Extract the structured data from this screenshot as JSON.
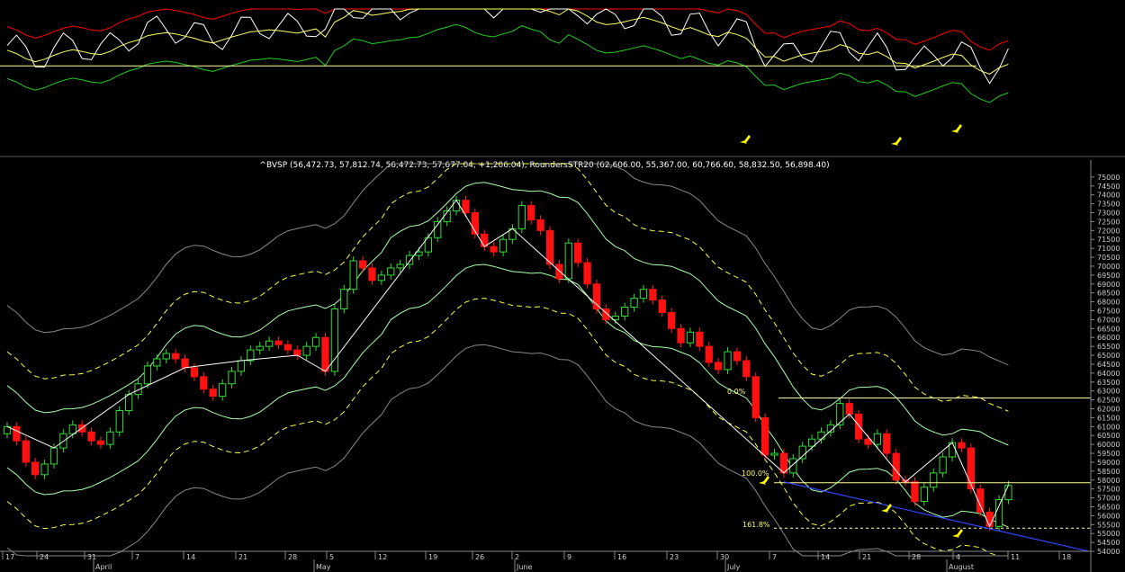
{
  "chart_data": [
    {
      "type": "line",
      "panel": "indicator",
      "title": "",
      "series": [
        {
          "color": "#ff0000",
          "values": [
            76.3,
            76.3,
            76.3,
            76.3,
            76.3,
            76.3,
            76.3,
            76.3,
            76.3,
            76.3,
            76.3,
            76.3,
            76.3,
            76.3,
            76.3,
            76.3,
            76.3,
            76.3,
            76.3,
            76.3,
            76.3,
            76.3,
            76.3,
            76.3,
            76.3,
            76.3,
            76.3,
            76.3,
            76.3,
            76.3,
            76.3,
            76.3,
            76.3,
            76.3,
            76.3,
            76.3,
            76.3,
            76.3,
            76.3,
            76.3,
            76.3,
            76.3,
            76.3,
            76.3,
            76.3,
            76.3,
            76.3,
            76.3,
            76.3,
            76.3,
            76.3,
            76.3,
            76.3,
            76.3,
            76.3,
            76.3,
            76.3,
            76.3,
            76.3,
            76.3,
            76.3,
            76.3,
            76.3,
            76.3,
            76.3,
            76.3,
            76.3,
            76.3,
            76.3,
            76.3,
            76.3,
            76.3,
            76.3,
            76.3,
            76.3,
            76.3,
            76.3,
            76.3,
            76.3,
            76.3,
            76.3,
            76.3,
            76.3,
            76.3,
            76.3,
            76.3,
            76.3,
            76.3,
            76.3,
            76.3,
            76.3,
            76.3,
            76.3,
            76.3,
            76.3,
            76.3,
            76.3,
            76.3,
            76.3,
            76.3
          ]
        },
        {
          "color": "#ffffff",
          "values": []
        },
        {
          "color": "#ffff66",
          "values": []
        },
        {
          "color": "#22cc22",
          "values": []
        }
      ],
      "hlines": [
        {
          "color": "#ffff99"
        }
      ]
    },
    {
      "type": "candlestick",
      "panel": "price",
      "title": "^BVSP (56,472.73, 57,812.74, 56,472.73, 57,677.04, +1,206.04), RoundersSTR20 (62,606.00, 55,367.00, 60,766.60, 58,832.50, 56,898.40)",
      "ylim": [
        53750,
        75750
      ],
      "y_ticks": [
        54000,
        54500,
        55000,
        55500,
        56000,
        56500,
        57000,
        57500,
        58000,
        58500,
        59000,
        59500,
        60000,
        60500,
        61000,
        61500,
        62000,
        62500,
        63000,
        63500,
        64000,
        64500,
        65000,
        65500,
        66000,
        66500,
        67000,
        67500,
        68000,
        68500,
        69000,
        69500,
        70000,
        70500,
        71000,
        71500,
        72000,
        72500,
        73000,
        73500,
        74000,
        74500,
        75000
      ],
      "x_day_labels": [
        "17",
        "24",
        "31",
        "7",
        "14",
        "21",
        "28",
        "5",
        "12",
        "19",
        "26",
        "2",
        "9",
        "16",
        "23",
        "30",
        "7",
        "14",
        "21",
        "28",
        "4",
        "11",
        "18"
      ],
      "x_month_labels": [
        "April",
        "May",
        "June",
        "July",
        "August"
      ],
      "closes": [
        61000,
        60200,
        59000,
        58300,
        58900,
        59800,
        60600,
        61100,
        60700,
        60200,
        60000,
        60700,
        61900,
        62800,
        63400,
        64400,
        64800,
        65100,
        64800,
        64300,
        63800,
        63100,
        62700,
        63400,
        64100,
        64700,
        65300,
        65500,
        65800,
        65600,
        65300,
        65000,
        65500,
        66000,
        64100,
        67600,
        68700,
        70300,
        69900,
        69200,
        69500,
        69900,
        70100,
        70600,
        70800,
        71600,
        72500,
        73100,
        73700,
        73000,
        71800,
        71100,
        70800,
        71500,
        72100,
        73400,
        72600,
        72000,
        70100,
        69300,
        71300,
        70200,
        69000,
        67600,
        67000,
        67200,
        67700,
        68200,
        68700,
        68100,
        67400,
        66500,
        65700,
        66300,
        65500,
        64600,
        64200,
        65200,
        64700,
        63800,
        61500,
        59400,
        59500,
        58400,
        59200,
        59900,
        60300,
        60700,
        61100,
        62300,
        61700,
        60300,
        60000,
        60600,
        59500,
        58000,
        57900,
        56800,
        57600,
        58400,
        59300,
        60100,
        59800,
        57500,
        56200,
        55400,
        56900,
        57700
      ]
    }
  ],
  "annotations": {
    "fib_0": "0.0%",
    "fib_100": "100.0%",
    "fib_161": "161.8%"
  }
}
